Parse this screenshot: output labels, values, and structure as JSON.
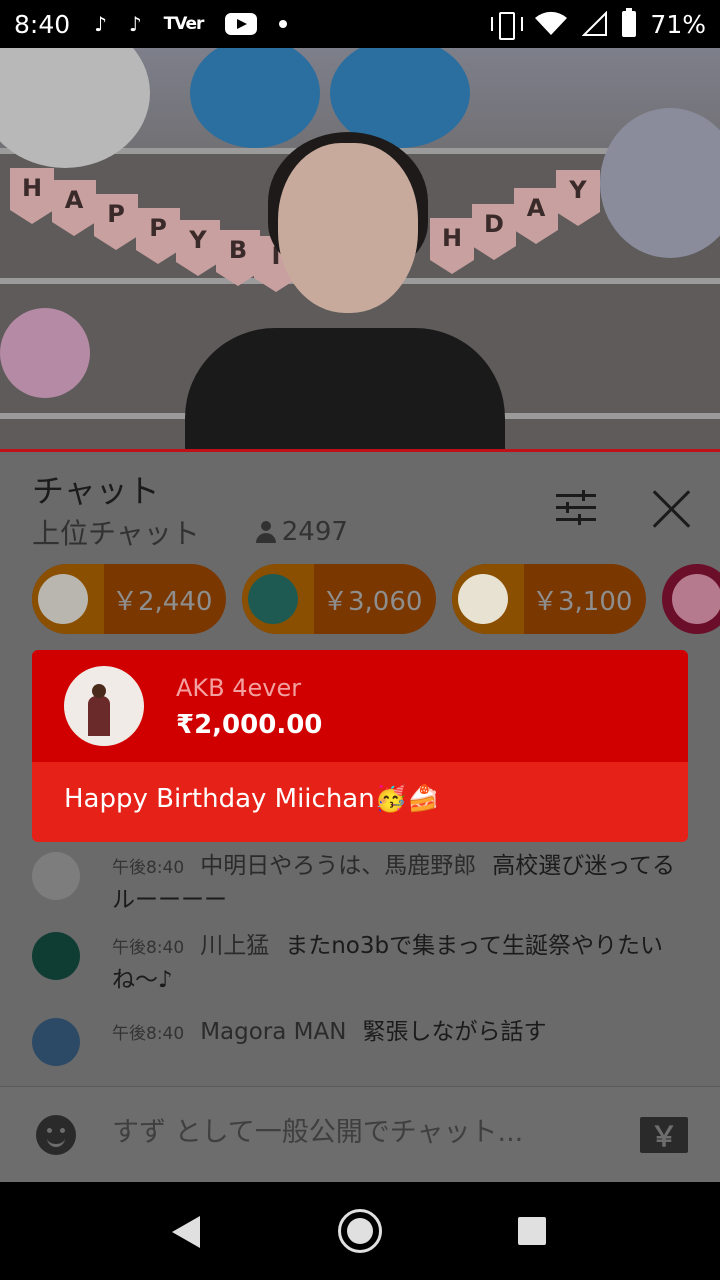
{
  "status_bar": {
    "time": "8:40",
    "app_icons": [
      "tiktok-icon",
      "tiktok-icon",
      "tver-icon",
      "youtube-icon",
      "notification-dot"
    ],
    "tver_label": "TVer",
    "battery": "71%"
  },
  "video": {
    "banner_letters": [
      "H",
      "A",
      "P",
      "P",
      "Y",
      "B",
      "I",
      "",
      "H",
      "D",
      "A",
      "Y"
    ]
  },
  "chat": {
    "title": "チャット",
    "mode": "上位チャット",
    "viewers": "2497",
    "tickers": [
      {
        "amount": "￥2,440",
        "color": "#7a3800"
      },
      {
        "amount": "￥3,060",
        "color": "#7a3800"
      },
      {
        "amount": "￥3,100",
        "color": "#7a3800"
      }
    ],
    "superchat": {
      "author": "AKB 4ever",
      "amount": "₹2,000.00",
      "message": "Happy Birthday Miichan🥳🍰"
    },
    "messages": [
      {
        "time": "午後8:40",
        "author": "中明日やろうは、馬鹿野郎",
        "text": "高校選び迷ってるルーーーー"
      },
      {
        "time": "午後8:40",
        "author": "川上猛",
        "text": "またno3bで集まって生誕祭やりたいね〜♪"
      },
      {
        "time": "午後8:40",
        "author": "Magora MAN",
        "text": "緊張しながら話す"
      }
    ],
    "input_placeholder": "すず として一般公開でチャット...",
    "yen_label": "￥"
  },
  "colors": {
    "superchat_header": "#d00000",
    "superchat_body": "#e62117",
    "video_divider": "#c0101a"
  }
}
